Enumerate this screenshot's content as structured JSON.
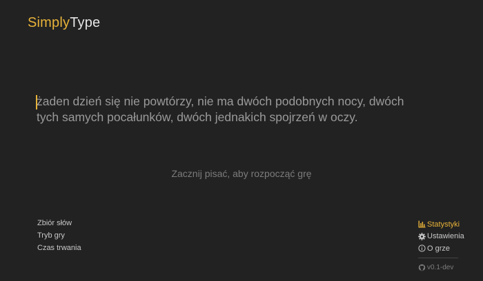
{
  "app": {
    "logo_part1": "Simply",
    "logo_part2": "Type"
  },
  "game": {
    "text_line1": "żaden dzień się nie powtórzy, nie ma dwóch podobnych nocy, dwóch",
    "text_line2": "tych samych pocałunków, dwóch jednakich spojrzeń w oczy.",
    "hint": "Zacznij pisać, aby rozpocząć grę"
  },
  "left_menu": {
    "word_set": "Zbiór słów",
    "game_mode": "Tryb gry",
    "duration": "Czas trwania"
  },
  "right_menu": {
    "stats": "Statystyki",
    "settings": "Ustawienia",
    "about": "O grze",
    "version": "v0.1-dev"
  },
  "colors": {
    "background": "#222222",
    "accent": "#e8b339",
    "text": "#9a9a9a"
  },
  "icons": {
    "stats": "bar-chart-icon",
    "settings": "gear-icon",
    "about": "info-icon",
    "version": "github-icon"
  }
}
